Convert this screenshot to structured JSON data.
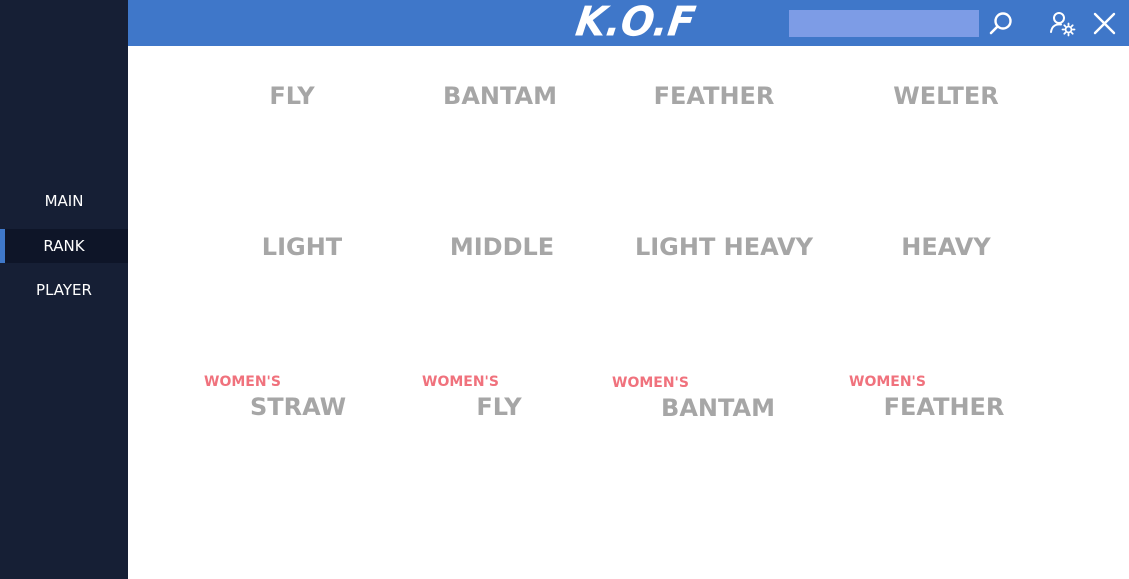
{
  "header": {
    "logo_text": "K.O.F",
    "search": {
      "value": "",
      "placeholder": ""
    },
    "icons": [
      "search-icon",
      "user-settings-icon",
      "close-icon"
    ],
    "colors": {
      "bar": "#3f77c9",
      "search_field": "#7d9ce6"
    }
  },
  "sidebar": {
    "items": [
      {
        "label": "MAIN",
        "active": false
      },
      {
        "label": "RANK",
        "active": true
      },
      {
        "label": "PLAYER",
        "active": false
      }
    ],
    "colors": {
      "background": "#161f35",
      "active_indicator": "#3f78c9"
    }
  },
  "divisions": {
    "men": [
      {
        "label": "FLY"
      },
      {
        "label": "BANTAM"
      },
      {
        "label": "FEATHER"
      },
      {
        "label": "WELTER"
      },
      {
        "label": "LIGHT"
      },
      {
        "label": "MIDDLE"
      },
      {
        "label": "LIGHT HEAVY"
      },
      {
        "label": "HEAVY"
      }
    ],
    "women": [
      {
        "prefix": "WOMEN'S",
        "label": "STRAW"
      },
      {
        "prefix": "WOMEN'S",
        "label": "FLY"
      },
      {
        "prefix": "WOMEN'S",
        "label": "BANTAM"
      },
      {
        "prefix": "WOMEN'S",
        "label": "FEATHER"
      }
    ],
    "colors": {
      "division_text": "#a6a6a6",
      "womens_prefix": "#f0727d"
    }
  }
}
